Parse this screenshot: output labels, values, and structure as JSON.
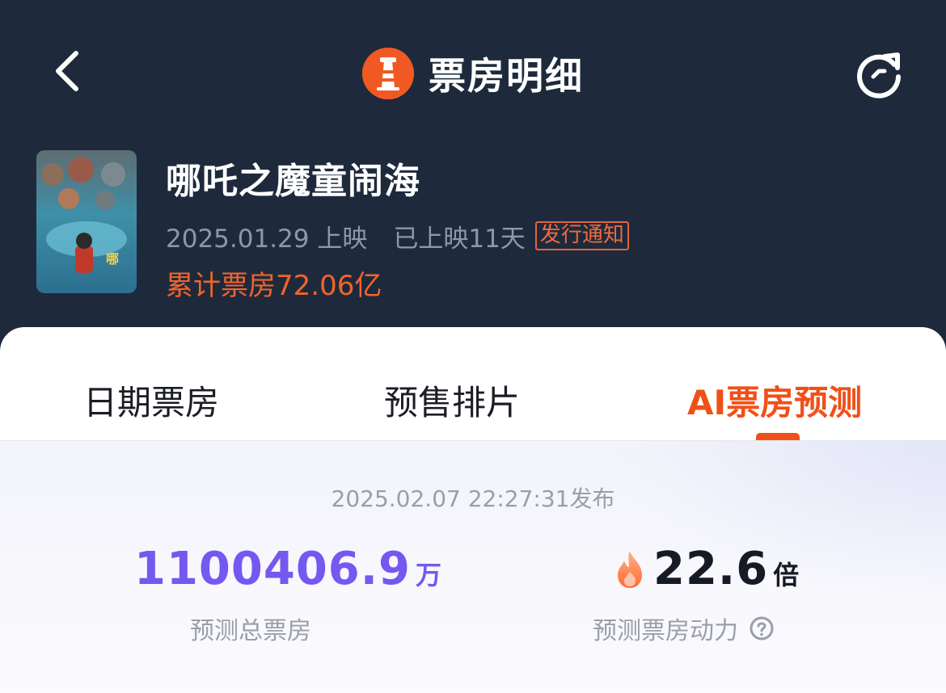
{
  "header": {
    "title": "票房明细",
    "back_icon": "chevron-left-icon",
    "refresh_icon": "refresh-icon",
    "logo_icon": "lighthouse-logo-icon"
  },
  "movie": {
    "title": "哪吒之魔童闹海",
    "release_date": "2025.01.29 上映",
    "days_on_screen": "已上映11天",
    "notice_tag": "发行通知",
    "cumulative_box_office": "累计票房72.06亿"
  },
  "tabs": [
    {
      "label": "日期票房",
      "active": false
    },
    {
      "label": "预售排片",
      "active": false
    },
    {
      "label": "AI票房预测",
      "active": true
    }
  ],
  "prediction": {
    "publish_time": "2025.02.07 22:27:31发布",
    "total": {
      "value": "1100406.9",
      "unit": "万",
      "label": "预测总票房"
    },
    "power": {
      "value": "22.6",
      "unit": "倍",
      "label": "预测票房动力",
      "icon": "flame-icon",
      "help_icon": "help-circle-icon"
    }
  },
  "colors": {
    "header_bg": "#1e2a3c",
    "accent_orange": "#f05018",
    "accent_purple": "#7558f0"
  }
}
